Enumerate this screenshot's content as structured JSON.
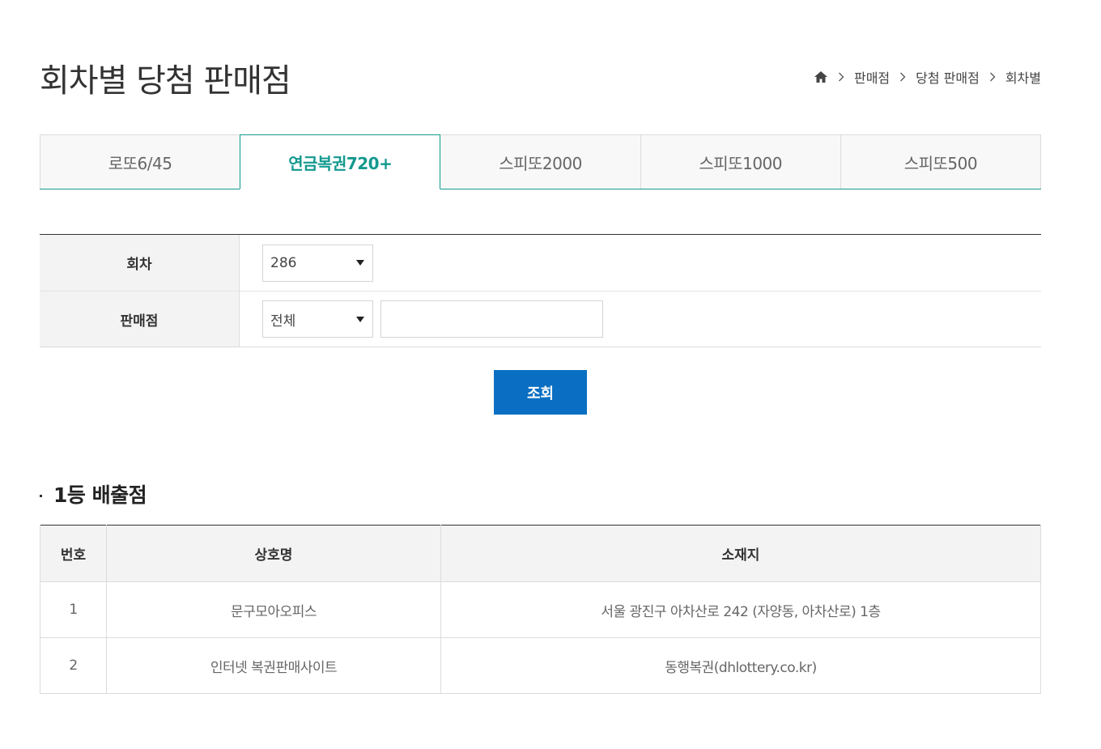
{
  "page": {
    "title": "회차별 당첨 판매점"
  },
  "breadcrumb": {
    "home_icon": "home-icon",
    "items": [
      "판매점",
      "당첨 판매점",
      "회차별"
    ]
  },
  "tabs": [
    {
      "label": "로또6/45",
      "active": false
    },
    {
      "label": "연금복권720+",
      "active": true
    },
    {
      "label": "스피또2000",
      "active": false
    },
    {
      "label": "스피또1000",
      "active": false
    },
    {
      "label": "스피또500",
      "active": false
    }
  ],
  "search": {
    "round_label": "회차",
    "round_value": "286",
    "store_label": "판매점",
    "store_value": "전체",
    "store_input_value": "",
    "button_label": "조회"
  },
  "results": {
    "section_title": "1등 배출점",
    "headers": [
      "번호",
      "상호명",
      "소재지"
    ],
    "rows": [
      [
        "1",
        "문구모아오피스",
        "서울 광진구 아차산로 242 (자양동, 아차산로) 1층"
      ],
      [
        "2",
        "인터넷 복권판매사이트",
        "동행복권(dhlottery.co.kr)"
      ]
    ]
  },
  "colors": {
    "accent_teal": "#13998f",
    "button_blue": "#0a6fc2"
  }
}
